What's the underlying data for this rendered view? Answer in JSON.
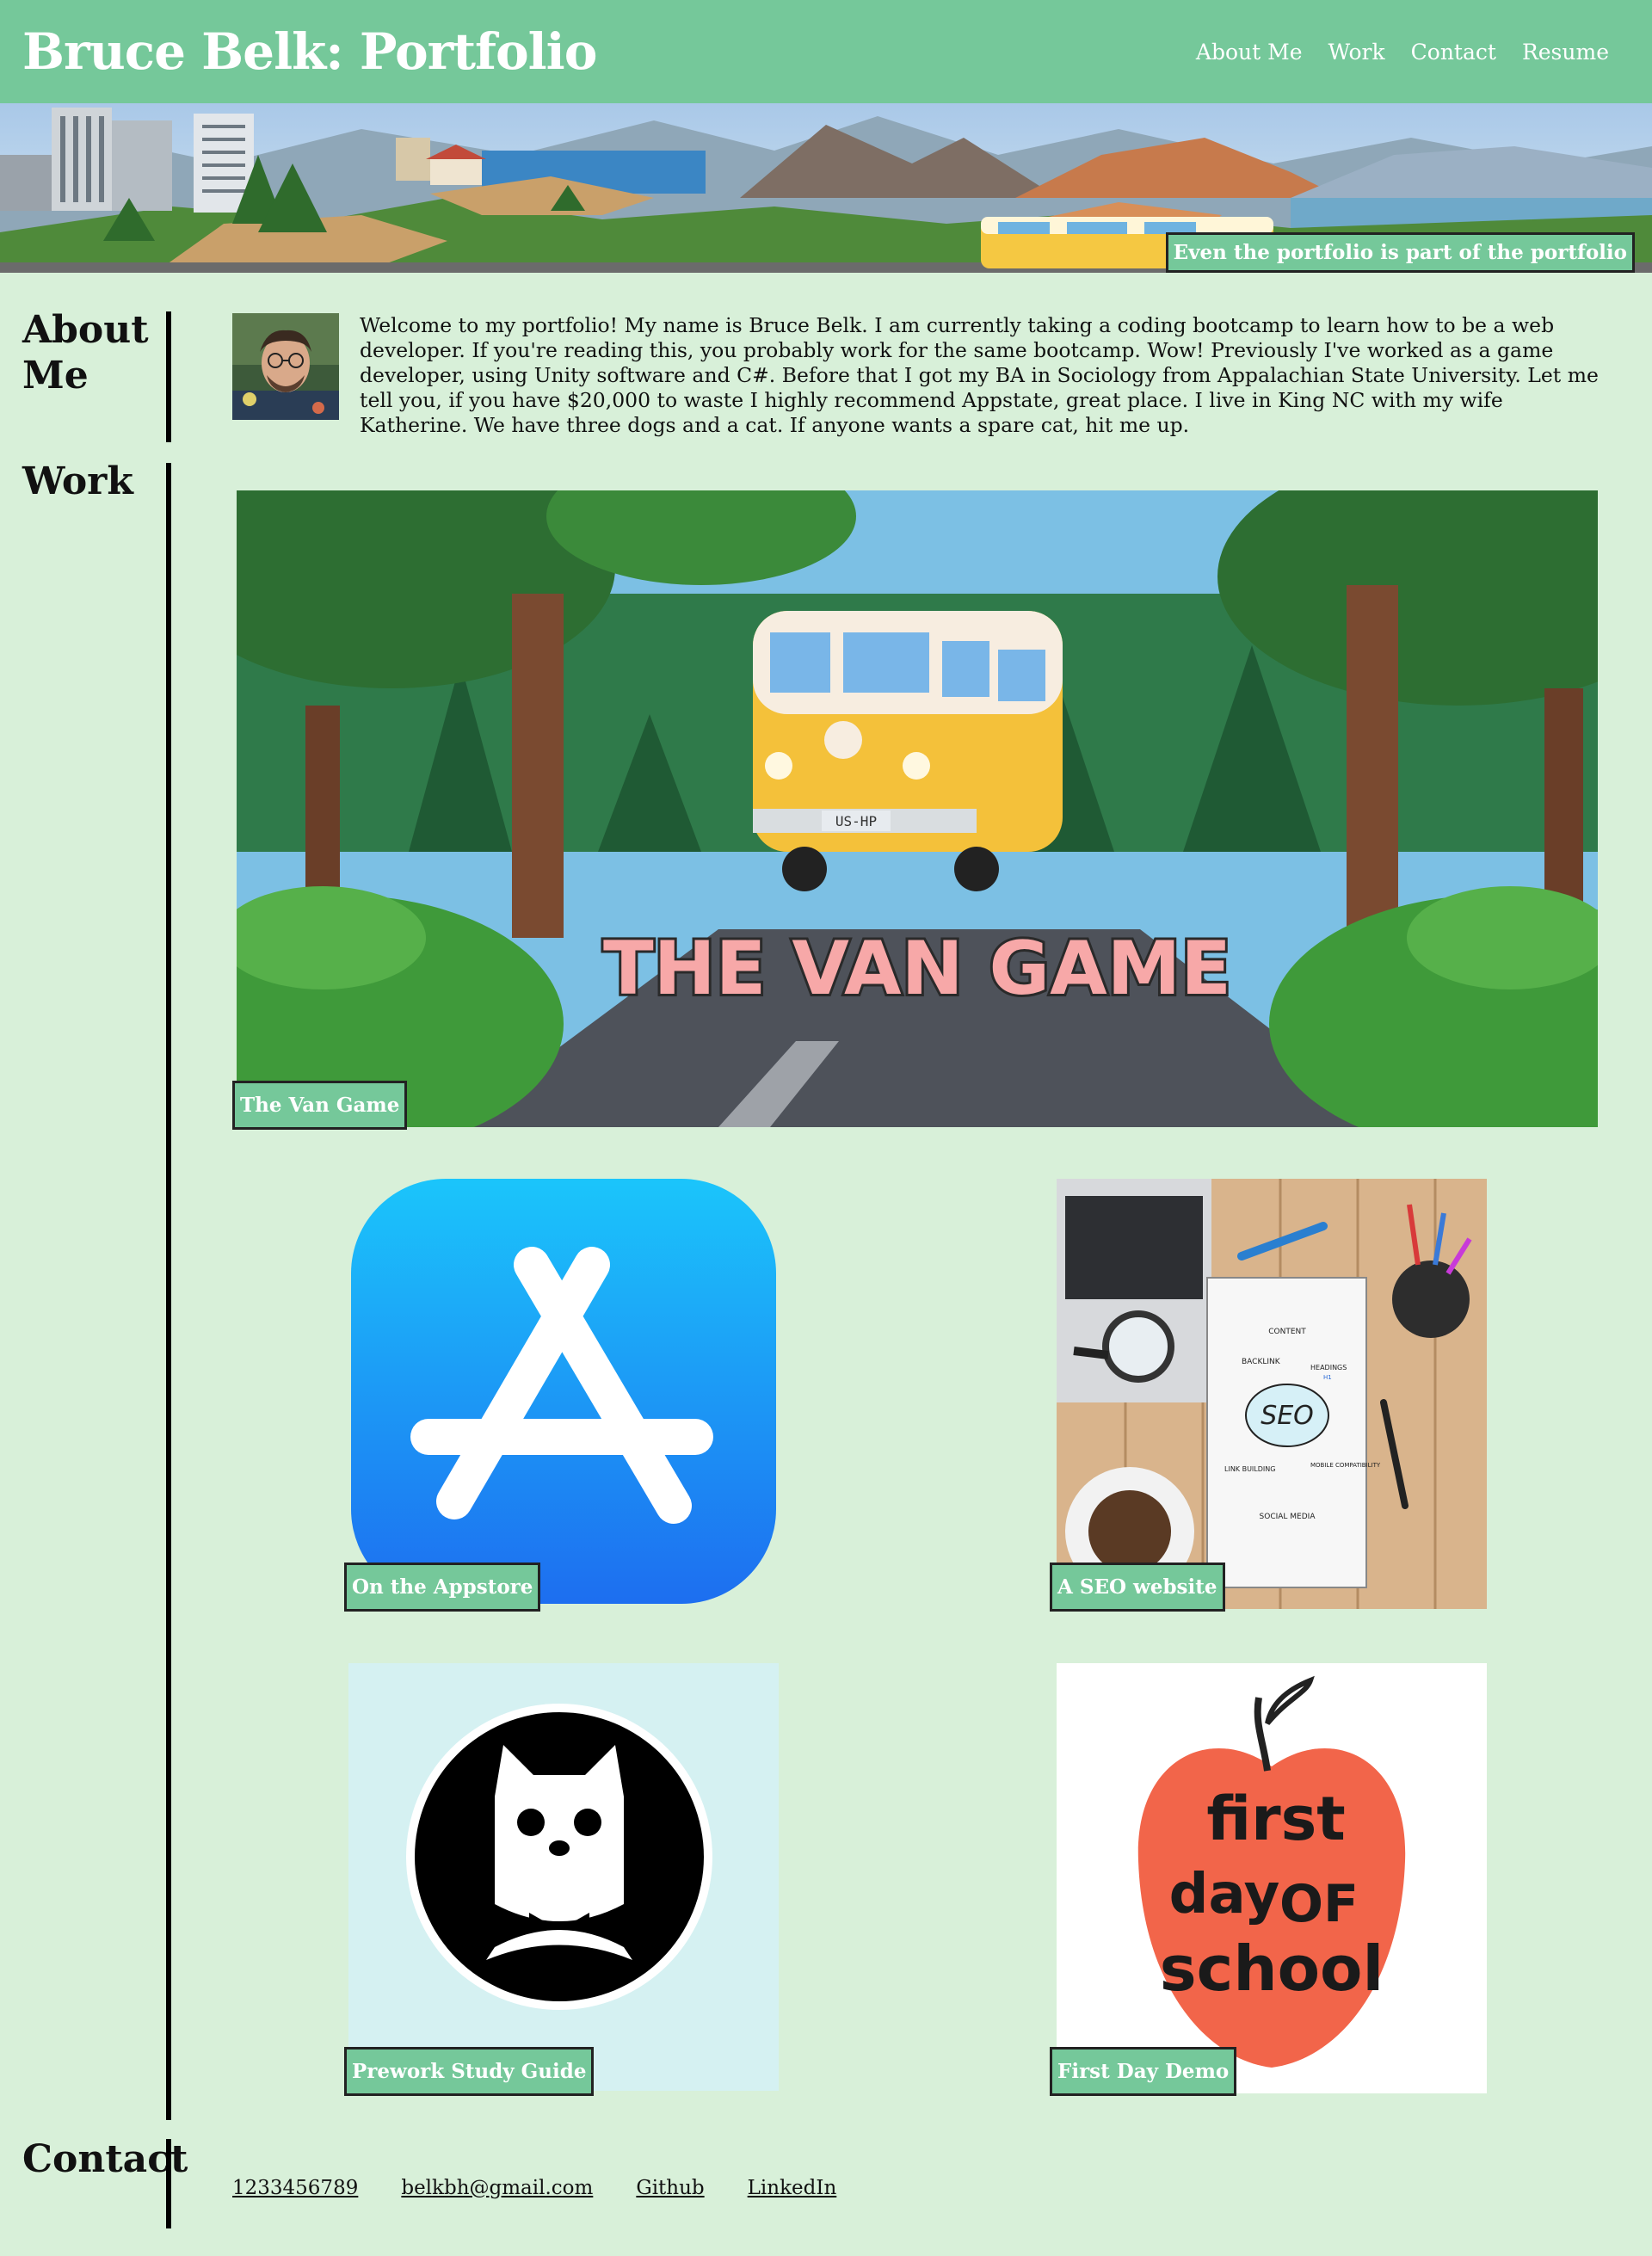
{
  "header": {
    "title": "Bruce Belk: Portfolio",
    "nav": [
      "About Me",
      "Work",
      "Contact",
      "Resume"
    ]
  },
  "hero": {
    "caption": "Even the portfolio is part of the portfolio"
  },
  "about": {
    "heading": "About Me",
    "text": "Welcome to my portfolio! My name is Bruce Belk. I am currently taking a coding bootcamp to learn how to be a web developer. If you're reading this, you probably work for the same bootcamp. Wow! Previously I've worked as a game developer, using Unity software and C#. Before that I got my BA in Sociology from Appalachian State University. Let me tell you, if you have $20,000 to waste I highly recommend Appstate, great place. I live in King NC with my wife Katherine. We have three dogs and a cat. If anyone wants a spare cat, hit me up."
  },
  "work": {
    "heading": "Work",
    "featured": {
      "label": "The Van Game",
      "image_text": "THE VAN GAME",
      "plate": "US-HP"
    },
    "items": [
      {
        "label": "On the Appstore"
      },
      {
        "label": "A SEO website",
        "seo_words": [
          "CONTENT",
          "BACKLINK",
          "HEADINGS",
          "SEO",
          "LINK BUILDING",
          "MOBILE COMPATIBILITY",
          "SOCIAL MEDIA",
          "H1"
        ]
      },
      {
        "label": "Prework Study Guide"
      },
      {
        "label": "First Day Demo",
        "apple_text": [
          "first",
          "day",
          "OF",
          "school"
        ]
      }
    ]
  },
  "contact": {
    "heading": "Contact",
    "links": [
      "1233456789",
      "belkbh@gmail.com",
      "Github",
      "LinkedIn"
    ]
  },
  "colors": {
    "accent": "#75c89a",
    "background": "#d8f0d9",
    "border": "#222222"
  }
}
